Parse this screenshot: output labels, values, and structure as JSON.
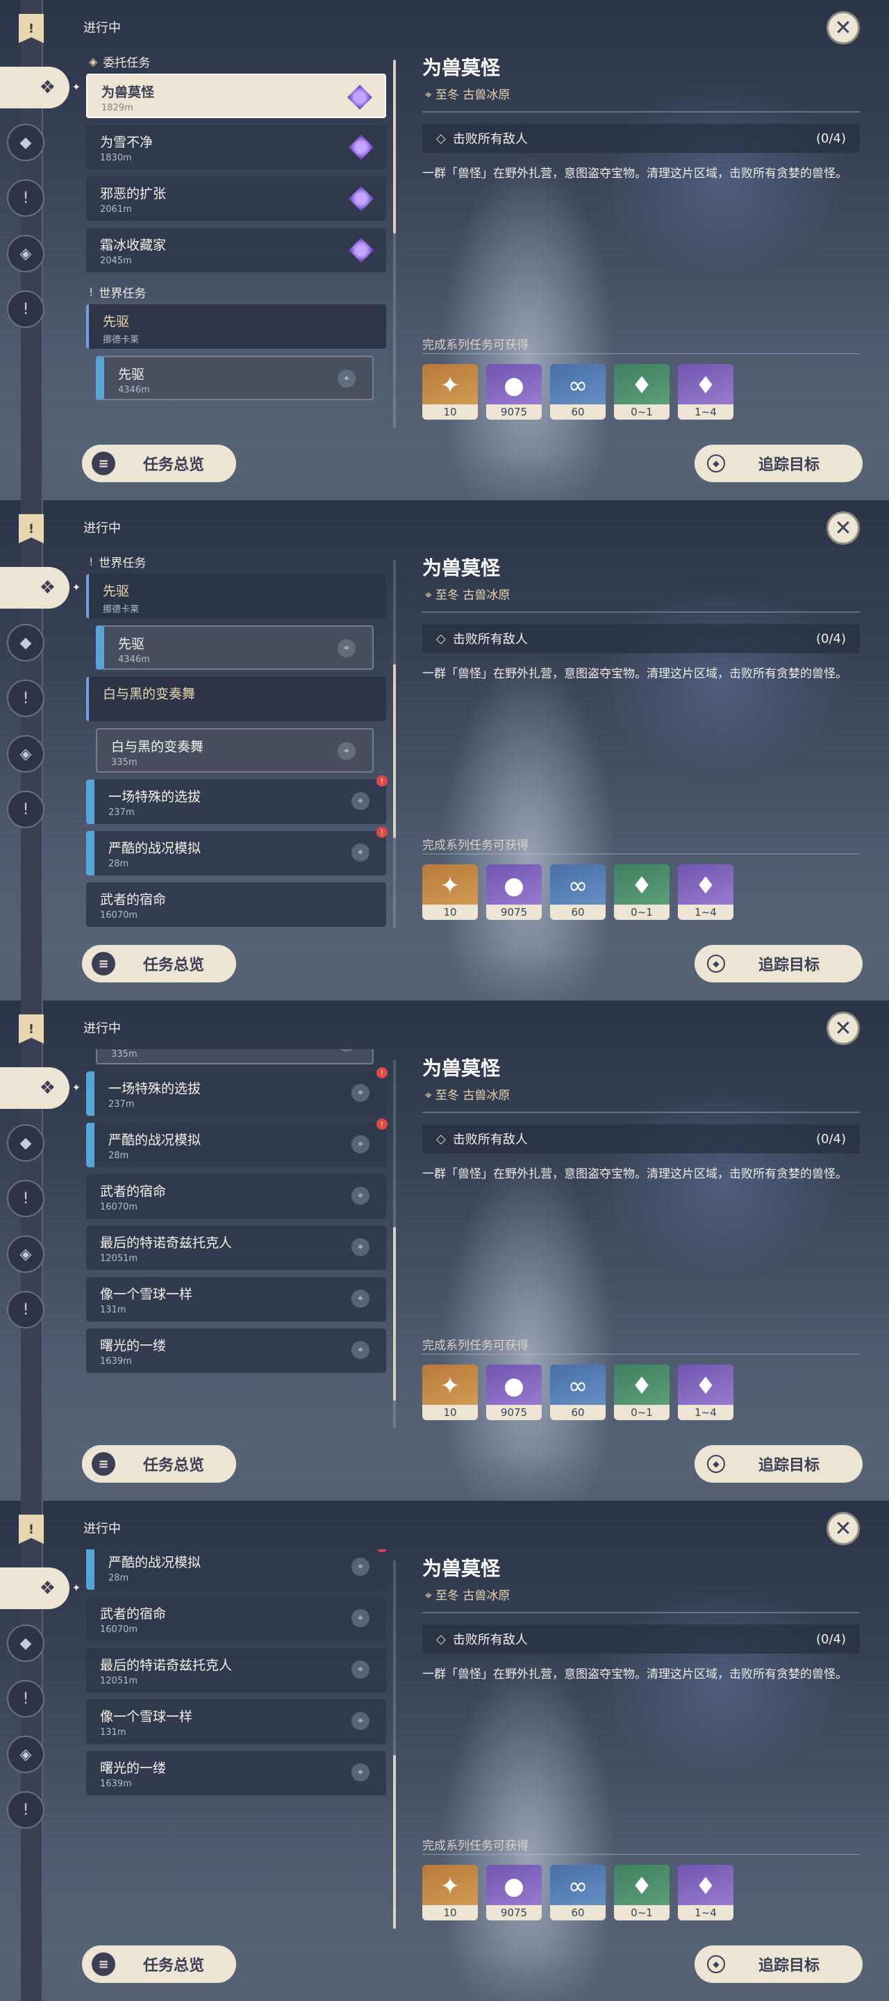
{
  "status_label": "进行中",
  "categories": {
    "commission": "委托任务",
    "world": "世界任务",
    "white_black": "白与黑的变奏舞"
  },
  "quests": {
    "q1": {
      "title": "为兽莫怪",
      "dist": "1829m"
    },
    "q2": {
      "title": "为雪不净",
      "dist": "1830m"
    },
    "q3": {
      "title": "邪恶的扩张",
      "dist": "2061m"
    },
    "q4": {
      "title": "霜冰收藏家",
      "dist": "2045m"
    },
    "pioneer_parent": {
      "title": "先驱",
      "subtitle": "挪德卡莱"
    },
    "pioneer": {
      "title": "先驱",
      "dist": "4346m"
    },
    "wb": {
      "title": "白与黑的变奏舞",
      "dist": "335m"
    },
    "special_sel": {
      "title": "一场特殊的选拔",
      "dist": "237m"
    },
    "sim": {
      "title": "严酷的战况模拟",
      "dist": "28m"
    },
    "warrior": {
      "title": "武者的宿命",
      "dist": "16070m"
    },
    "last": {
      "title": "最后的特诺奇兹托克人",
      "dist": "12051m"
    },
    "snowball": {
      "title": "像一个雪球一样",
      "dist": "131m"
    },
    "dawn": {
      "title": "曙光的一缕",
      "dist": "1639m"
    }
  },
  "detail": {
    "title": "为兽莫怪",
    "location": "至冬 古兽冰原",
    "objective": "击败所有敌人",
    "progress": "(0/4)",
    "description": "一群「兽怪」在野外扎营，意图盗夺宝物。清理这片区域，击败所有贪婪的兽怪。",
    "reward_label": "完成系列任务可获得",
    "rewards": [
      {
        "qty": "10",
        "icon": "primogem-icon"
      },
      {
        "qty": "9075",
        "icon": "mora-icon"
      },
      {
        "qty": "60",
        "icon": "exp-icon"
      },
      {
        "qty": "0~1",
        "icon": "crystal-green-icon"
      },
      {
        "qty": "1~4",
        "icon": "crystal-purple-icon"
      }
    ]
  },
  "buttons": {
    "overview": "任务总览",
    "track": "追踪目标"
  },
  "colors": {
    "cream": "#ece5d4",
    "navy": "#3b3f54",
    "gold": "#e8d7ae",
    "blue": "#58a6d8"
  }
}
